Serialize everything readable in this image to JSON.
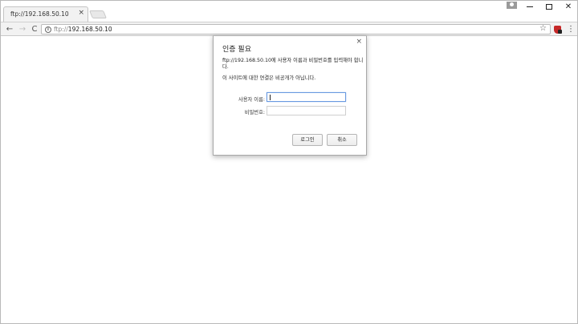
{
  "tab": {
    "title": "ftp://192.168.50.10",
    "close_glyph": "×"
  },
  "window_controls": {
    "close_glyph": "✕"
  },
  "toolbar": {
    "back_glyph": "←",
    "forward_glyph": "→",
    "reload_glyph": "C",
    "url_scheme": "ftp://",
    "url_host": "192.168.50.10",
    "info_glyph": "i",
    "star_glyph": "☆",
    "menu_glyph": "⋮"
  },
  "dialog": {
    "close_glyph": "×",
    "title": "인증 필요",
    "message": "ftp://192.168.50.10에 사용자 이름과 비밀번호를 입력해야 합니다.",
    "warning": "이 사이트에 대한 연결은 비공개가 아닙니다.",
    "username_label": "사용자 이름:",
    "password_label": "비밀번호:",
    "username_value": "",
    "password_value": "",
    "login_label": "로그인",
    "cancel_label": "취소"
  },
  "colors": {
    "accent_focus": "#6a9ae0",
    "extension_red": "#c62828"
  },
  "icons": [
    "back-arrow-icon",
    "forward-arrow-icon",
    "reload-icon",
    "info-icon",
    "star-icon",
    "extension-icon",
    "menu-icon",
    "close-icon",
    "profile-icon"
  ]
}
